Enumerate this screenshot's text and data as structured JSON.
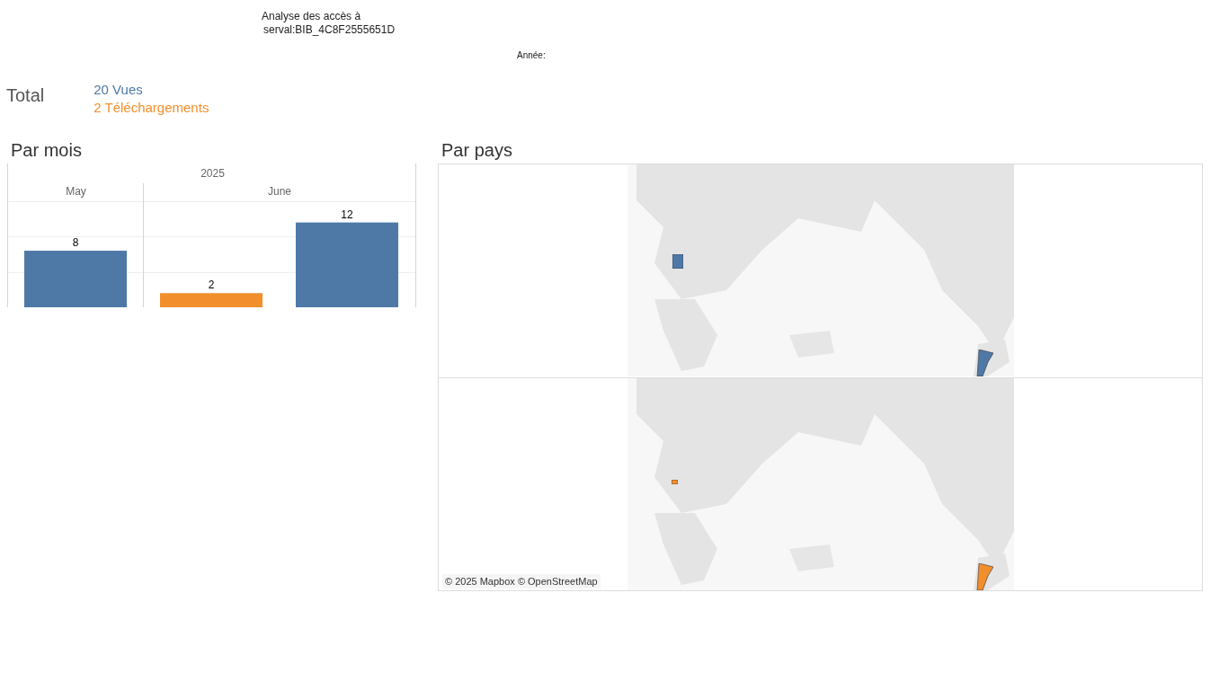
{
  "title": {
    "line_1": "Analyse des accès à",
    "line_2": "serval:BIB_4C8F2555651D"
  },
  "filter": {
    "label": "Année:"
  },
  "total": {
    "label": "Total",
    "items": [
      {
        "text": "20 Vues",
        "color": "#4e79a7"
      },
      {
        "text": "2 Téléchargements",
        "color": "#f28e2b"
      }
    ]
  },
  "by_month": {
    "heading": "Par mois",
    "year": "2025",
    "chart_data": {
      "type": "bar",
      "categories": [
        "May",
        "June"
      ],
      "data_labels": true,
      "series": [
        {
          "color": "#f28e2b",
          "values": [
            null,
            2
          ]
        },
        {
          "color": "#4e79a7",
          "values": [
            8,
            12
          ]
        }
      ]
    }
  },
  "by_country": {
    "heading": "Par pays",
    "maps": [
      {
        "color": "#4e79a7"
      },
      {
        "color": "#f28e2b",
        "attribution": "© 2025 Mapbox © OpenStreetMap"
      }
    ]
  }
}
